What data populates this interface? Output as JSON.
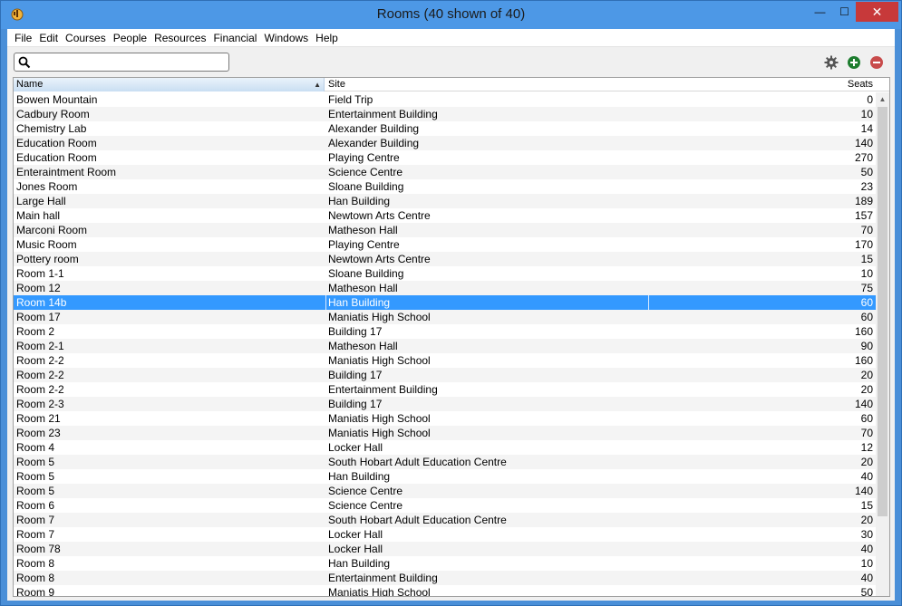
{
  "window": {
    "title": "Rooms (40 shown of 40)",
    "close_glyph": "✕",
    "min_glyph": "—",
    "max_glyph": "☐"
  },
  "menu": [
    "File",
    "Edit",
    "Courses",
    "People",
    "Resources",
    "Financial",
    "Windows",
    "Help"
  ],
  "search": {
    "value": "",
    "placeholder": ""
  },
  "toolbar_icons": [
    "gear-icon",
    "add-icon",
    "remove-icon"
  ],
  "colors": {
    "selection": "#3399ff",
    "add": "#1e7d2f",
    "remove": "#c84b4b",
    "gear": "#555555"
  },
  "columns": {
    "name": "Name",
    "site": "Site",
    "seats": "Seats"
  },
  "selected_index": 14,
  "rows": [
    [
      "Bowen Mountain",
      "Field Trip",
      "0"
    ],
    [
      "Cadbury Room",
      "Entertainment Building",
      "10"
    ],
    [
      "Chemistry Lab",
      "Alexander Building",
      "14"
    ],
    [
      "Education Room",
      "Alexander Building",
      "140"
    ],
    [
      "Education Room",
      "Playing Centre",
      "270"
    ],
    [
      "Enteraintment Room",
      "Science Centre",
      "50"
    ],
    [
      "Jones Room",
      "Sloane Building",
      "23"
    ],
    [
      "Large Hall",
      "Han Building",
      "189"
    ],
    [
      "Main hall",
      "Newtown Arts Centre",
      "157"
    ],
    [
      "Marconi Room",
      "Matheson Hall",
      "70"
    ],
    [
      "Music Room",
      "Playing Centre",
      "170"
    ],
    [
      "Pottery room",
      "Newtown Arts Centre",
      "15"
    ],
    [
      "Room 1-1",
      "Sloane Building",
      "10"
    ],
    [
      "Room 12",
      "Matheson Hall",
      "75"
    ],
    [
      "Room 14b",
      "Han Building",
      "60"
    ],
    [
      "Room 17",
      "Maniatis High School",
      "60"
    ],
    [
      "Room 2",
      "Building 17",
      "160"
    ],
    [
      "Room 2-1",
      "Matheson Hall",
      "90"
    ],
    [
      "Room 2-2",
      "Maniatis High School",
      "160"
    ],
    [
      "Room 2-2",
      "Building 17",
      "20"
    ],
    [
      "Room 2-2",
      "Entertainment Building",
      "20"
    ],
    [
      "Room 2-3",
      "Building 17",
      "140"
    ],
    [
      "Room 21",
      "Maniatis High School",
      "60"
    ],
    [
      "Room 23",
      "Maniatis High School",
      "70"
    ],
    [
      "Room 4",
      "Locker Hall",
      "12"
    ],
    [
      "Room 5",
      "South Hobart Adult Education Centre",
      "20"
    ],
    [
      "Room 5",
      "Han Building",
      "40"
    ],
    [
      "Room 5",
      "Science Centre",
      "140"
    ],
    [
      "Room 6",
      "Science Centre",
      "15"
    ],
    [
      "Room 7",
      "South Hobart Adult Education Centre",
      "20"
    ],
    [
      "Room 7",
      "Locker Hall",
      "30"
    ],
    [
      "Room 78",
      "Locker Hall",
      "40"
    ],
    [
      "Room 8",
      "Han Building",
      "10"
    ],
    [
      "Room 8",
      "Entertainment Building",
      "40"
    ],
    [
      "Room 9",
      "Maniatis High School",
      "50"
    ]
  ]
}
